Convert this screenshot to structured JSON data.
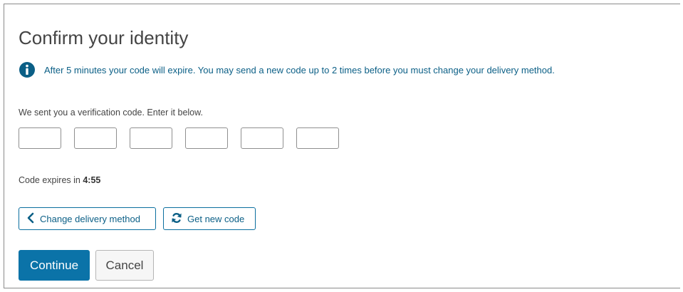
{
  "page": {
    "title": "Confirm your identity"
  },
  "info": {
    "icon": "info-circle-icon",
    "color": "#0b5f86",
    "message": "After 5 minutes your code will expire. You may send a new code up to 2 times before you must change your delivery method."
  },
  "verification": {
    "instruction": "We sent you a verification code. Enter it below.",
    "code_fields": [
      "",
      "",
      "",
      "",
      "",
      ""
    ]
  },
  "timer": {
    "label": "Code expires in ",
    "value": "4:55"
  },
  "actions": {
    "change_delivery_label": "Change delivery method",
    "change_delivery_icon": "chevron-left-icon",
    "get_new_code_label": "Get new code",
    "get_new_code_icon": "refresh-icon",
    "continue_label": "Continue",
    "cancel_label": "Cancel"
  },
  "colors": {
    "accent": "#0b73a8",
    "link": "#0b5f86"
  }
}
